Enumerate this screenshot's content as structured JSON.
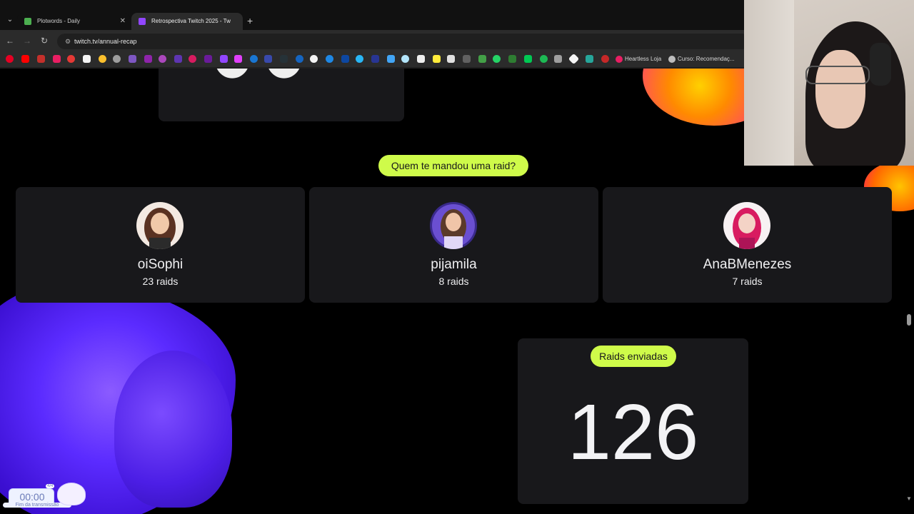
{
  "browser": {
    "tabs": [
      {
        "title": "Plotwords - Daily",
        "active": false,
        "close": "✕"
      },
      {
        "title": "Retrospectiva Twitch 2025 - Tw",
        "active": true
      }
    ],
    "new_tab": "+",
    "url": "twitch.tv/annual-recap",
    "bookmarks": [
      {
        "label": "Heartless Loja"
      },
      {
        "label": "Curso: Recomendaç..."
      }
    ]
  },
  "recap": {
    "raid_question": "Quem te mandou uma raid?",
    "raiders": [
      {
        "name": "oiSophi",
        "count": "23 raids"
      },
      {
        "name": "pijamila",
        "count": "8 raids"
      },
      {
        "name": "AnaBMenezes",
        "count": "7 raids"
      }
    ],
    "raids_sent_label": "Raids enviadas",
    "raids_sent_value": "126"
  },
  "overlay": {
    "timer": "00:00",
    "timer_caption": "Fim da transmissão",
    "timer_count": "4/4"
  },
  "colors": {
    "accent_green": "#cffb4a",
    "card_bg": "#18181b",
    "twitch_purple": "#9146ff"
  }
}
